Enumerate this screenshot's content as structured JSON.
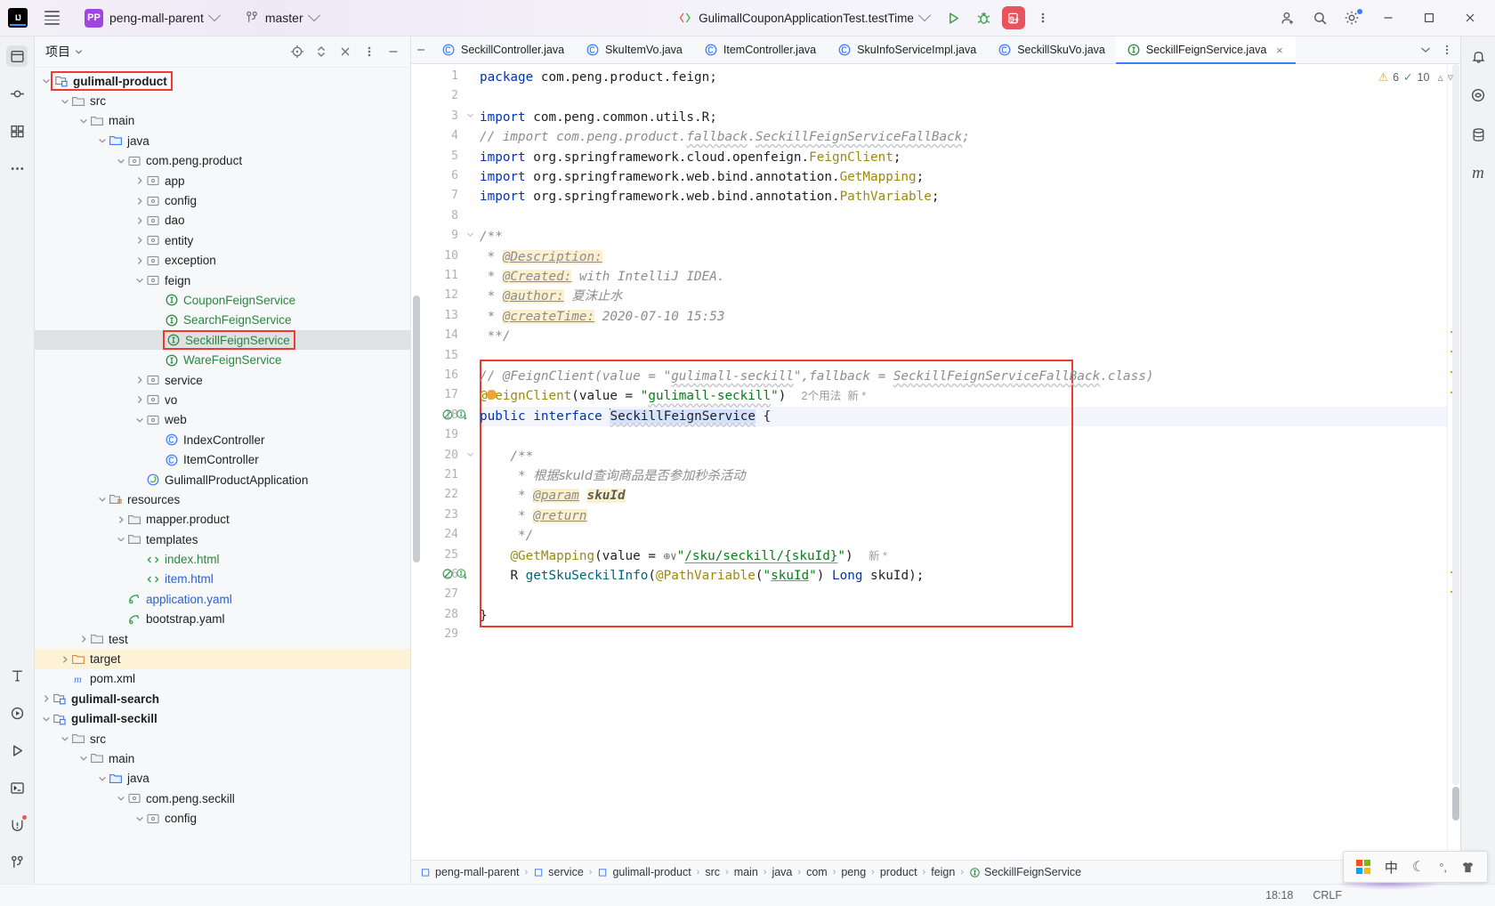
{
  "titlebar": {
    "project_badge": "PP",
    "project_name": "peng-mall-parent",
    "branch": "master",
    "run_config": "GulimallCouponApplicationTest.testTime",
    "debug_badge": "9+",
    "icons": [
      "ij-logo",
      "hamburger-icon",
      "chevron-down-icon",
      "branch-icon",
      "run-icon",
      "debug-icon",
      "services-icon",
      "more-vertical-icon",
      "add-user-icon",
      "search-icon",
      "settings-icon",
      "minimize-icon",
      "maximize-icon",
      "close-icon"
    ]
  },
  "left_rail": {
    "items": [
      {
        "name": "project-tool-icon",
        "glyph": "❐"
      },
      {
        "name": "commit-tool-icon",
        "glyph": "⬡"
      },
      {
        "name": "structure-tool-icon",
        "glyph": "⊞"
      },
      {
        "name": "more-tool-icon",
        "glyph": "⋯"
      }
    ],
    "bottom_items": [
      {
        "name": "ai-assistant-icon",
        "glyph": "Ŧ"
      },
      {
        "name": "run-widget-icon",
        "glyph": "▷"
      },
      {
        "name": "run-tool-icon",
        "glyph": "▷"
      },
      {
        "name": "terminal-tool-icon",
        "glyph": "⌨"
      },
      {
        "name": "problems-tool-icon",
        "glyph": "!"
      },
      {
        "name": "version-control-icon",
        "glyph": "⎇"
      }
    ]
  },
  "right_rail": {
    "items": [
      {
        "name": "notifications-icon",
        "glyph": "🔔"
      },
      {
        "name": "ai-chat-icon",
        "glyph": "◎"
      },
      {
        "name": "database-icon",
        "glyph": "⛃"
      },
      {
        "name": "maven-icon",
        "glyph": "m"
      }
    ]
  },
  "project_panel": {
    "title": "项目",
    "header_icons": [
      "locate-icon",
      "expand-collapse-icon",
      "collapse-all-icon",
      "more-options-icon",
      "hide-panel-icon"
    ],
    "tree": [
      {
        "depth": 1,
        "arrow": "down",
        "icon": "module-icon",
        "label": "gulimall-product",
        "style": "bold",
        "highlight": "red-box"
      },
      {
        "depth": 2,
        "arrow": "down",
        "icon": "folder-icon",
        "label": "src",
        "style": "plain"
      },
      {
        "depth": 3,
        "arrow": "down",
        "icon": "folder-icon",
        "label": "main",
        "style": "plain"
      },
      {
        "depth": 4,
        "arrow": "down",
        "icon": "source-root-icon",
        "label": "java",
        "style": "plain"
      },
      {
        "depth": 5,
        "arrow": "down",
        "icon": "package-icon",
        "label": "com.peng.product",
        "style": "plain"
      },
      {
        "depth": 6,
        "arrow": "right",
        "icon": "package-icon",
        "label": "app",
        "style": "plain"
      },
      {
        "depth": 6,
        "arrow": "right",
        "icon": "package-icon",
        "label": "config",
        "style": "plain"
      },
      {
        "depth": 6,
        "arrow": "right",
        "icon": "package-icon",
        "label": "dao",
        "style": "plain"
      },
      {
        "depth": 6,
        "arrow": "right",
        "icon": "package-icon",
        "label": "entity",
        "style": "plain"
      },
      {
        "depth": 6,
        "arrow": "right",
        "icon": "package-icon",
        "label": "exception",
        "style": "plain"
      },
      {
        "depth": 6,
        "arrow": "down",
        "icon": "package-icon",
        "label": "feign",
        "style": "plain"
      },
      {
        "depth": 7,
        "arrow": "none",
        "icon": "interface-icon",
        "label": "CouponFeignService",
        "style": "plain"
      },
      {
        "depth": 7,
        "arrow": "none",
        "icon": "interface-icon",
        "label": "SearchFeignService",
        "style": "plain"
      },
      {
        "depth": 7,
        "arrow": "none",
        "icon": "interface-icon",
        "label": "SeckillFeignService",
        "style": "plain",
        "selected": true,
        "highlight": "red-box"
      },
      {
        "depth": 7,
        "arrow": "none",
        "icon": "interface-icon",
        "label": "WareFeignService",
        "style": "plain"
      },
      {
        "depth": 6,
        "arrow": "right",
        "icon": "package-icon",
        "label": "service",
        "style": "plain"
      },
      {
        "depth": 6,
        "arrow": "right",
        "icon": "package-icon",
        "label": "vo",
        "style": "plain"
      },
      {
        "depth": 6,
        "arrow": "down",
        "icon": "package-icon",
        "label": "web",
        "style": "plain"
      },
      {
        "depth": 7,
        "arrow": "none",
        "icon": "class-icon",
        "label": "IndexController",
        "style": "plain"
      },
      {
        "depth": 7,
        "arrow": "none",
        "icon": "class-icon",
        "label": "ItemController",
        "style": "plain"
      },
      {
        "depth": 6,
        "arrow": "none",
        "icon": "spring-class-icon",
        "label": "GulimallProductApplication",
        "style": "plain"
      },
      {
        "depth": 4,
        "arrow": "down",
        "icon": "resource-root-icon",
        "label": "resources",
        "style": "plain"
      },
      {
        "depth": 5,
        "arrow": "right",
        "icon": "folder-icon",
        "label": "mapper.product",
        "style": "plain"
      },
      {
        "depth": 5,
        "arrow": "down",
        "icon": "folder-icon",
        "label": "templates",
        "style": "plain"
      },
      {
        "depth": 6,
        "arrow": "none",
        "icon": "html-icon",
        "label": "index.html",
        "style": "green"
      },
      {
        "depth": 6,
        "arrow": "none",
        "icon": "html-icon",
        "label": "item.html",
        "style": "blue"
      },
      {
        "depth": 5,
        "arrow": "none",
        "icon": "yaml-icon",
        "label": "application.yaml",
        "style": "blue"
      },
      {
        "depth": 5,
        "arrow": "none",
        "icon": "yaml-icon",
        "label": "bootstrap.yaml",
        "style": "plain"
      },
      {
        "depth": 3,
        "arrow": "right",
        "icon": "folder-icon",
        "label": "test",
        "style": "plain"
      },
      {
        "depth": 2,
        "arrow": "right",
        "icon": "excluded-folder-icon",
        "label": "target",
        "style": "plain",
        "row_highlight": "target"
      },
      {
        "depth": 2,
        "arrow": "none",
        "icon": "maven-file-icon",
        "label": "pom.xml",
        "style": "plain"
      },
      {
        "depth": 1,
        "arrow": "right",
        "icon": "module-icon",
        "label": "gulimall-search",
        "style": "bold"
      },
      {
        "depth": 1,
        "arrow": "down",
        "icon": "module-icon",
        "label": "gulimall-seckill",
        "style": "bold"
      },
      {
        "depth": 2,
        "arrow": "down",
        "icon": "folder-icon",
        "label": "src",
        "style": "plain"
      },
      {
        "depth": 3,
        "arrow": "down",
        "icon": "folder-icon",
        "label": "main",
        "style": "plain"
      },
      {
        "depth": 4,
        "arrow": "down",
        "icon": "source-root-icon",
        "label": "java",
        "style": "plain"
      },
      {
        "depth": 5,
        "arrow": "down",
        "icon": "package-icon",
        "label": "com.peng.seckill",
        "style": "plain"
      },
      {
        "depth": 6,
        "arrow": "down",
        "icon": "package-icon",
        "label": "config",
        "style": "plain"
      }
    ]
  },
  "editor": {
    "tabs": [
      {
        "label": "SeckillController.java",
        "icon": "class-icon",
        "active": false
      },
      {
        "label": "SkuItemVo.java",
        "icon": "class-icon",
        "active": false
      },
      {
        "label": "ItemController.java",
        "icon": "class-icon",
        "active": false
      },
      {
        "label": "SkuInfoServiceImpl.java",
        "icon": "class-icon",
        "active": false
      },
      {
        "label": "SeckillSkuVo.java",
        "icon": "class-icon",
        "active": false
      },
      {
        "label": "SeckillFeignService.java",
        "icon": "interface-icon",
        "active": true
      }
    ],
    "inspection": {
      "warnings": "6",
      "checks": "10"
    },
    "caret_position": "18:18",
    "line_separator": "CRLF",
    "lines": [
      {
        "n": 1,
        "text": "package com.peng.product.feign;"
      },
      {
        "n": 2,
        "text": ""
      },
      {
        "n": 3,
        "text": "import com.peng.common.utils.R;"
      },
      {
        "n": 4,
        "text": "// import com.peng.product.fallback.SeckillFeignServiceFallBack;"
      },
      {
        "n": 5,
        "text": "import org.springframework.cloud.openfeign.FeignClient;"
      },
      {
        "n": 6,
        "text": "import org.springframework.web.bind.annotation.GetMapping;"
      },
      {
        "n": 7,
        "text": "import org.springframework.web.bind.annotation.PathVariable;"
      },
      {
        "n": 8,
        "text": ""
      },
      {
        "n": 9,
        "text": "/**"
      },
      {
        "n": 10,
        "text": " * @Description:"
      },
      {
        "n": 11,
        "text": " * @Created: with IntelliJ IDEA."
      },
      {
        "n": 12,
        "text": " * @author: 夏沫止水"
      },
      {
        "n": 13,
        "text": " * @createTime: 2020-07-10 15:53"
      },
      {
        "n": 14,
        "text": " **/"
      },
      {
        "n": 15,
        "text": ""
      },
      {
        "n": 16,
        "text": "// @FeignClient(value = \"gulimall-seckill\",fallback = SeckillFeignServiceFallBack.class)"
      },
      {
        "n": 17,
        "text": "@FeignClient(value = \"gulimall-seckill\")  2个用法  新 *"
      },
      {
        "n": 18,
        "text": "public interface SeckillFeignService {"
      },
      {
        "n": 19,
        "text": ""
      },
      {
        "n": 20,
        "text": "    /**"
      },
      {
        "n": 21,
        "text": "     * 根据skuId查询商品是否参加秒杀活动"
      },
      {
        "n": 22,
        "text": "     * @param skuId"
      },
      {
        "n": 23,
        "text": "     * @return"
      },
      {
        "n": 24,
        "text": "     */"
      },
      {
        "n": 25,
        "text": "    @GetMapping(value = \"/sku/seckill/{skuId}\")  新 *"
      },
      {
        "n": 26,
        "text": "    R getSkuSeckilInfo(@PathVariable(\"skuId\") Long skuId);"
      },
      {
        "n": 27,
        "text": ""
      },
      {
        "n": 28,
        "text": "}"
      },
      {
        "n": 29,
        "text": ""
      }
    ],
    "usage_hints": {
      "feign_client": "2个用法  新 *",
      "get_mapping": "新 *"
    }
  },
  "breadcrumb": {
    "items": [
      {
        "label": "peng-mall-parent",
        "icon": "module-small-icon"
      },
      {
        "label": "service",
        "icon": "module-small-icon"
      },
      {
        "label": "gulimall-product",
        "icon": "module-small-icon"
      },
      {
        "label": "src",
        "icon": ""
      },
      {
        "label": "main",
        "icon": ""
      },
      {
        "label": "java",
        "icon": ""
      },
      {
        "label": "com",
        "icon": ""
      },
      {
        "label": "peng",
        "icon": ""
      },
      {
        "label": "product",
        "icon": ""
      },
      {
        "label": "feign",
        "icon": ""
      },
      {
        "label": "SeckillFeignService",
        "icon": "interface-icon"
      }
    ]
  },
  "statusbar": {
    "caret": "18:18",
    "separator": "CRLF"
  },
  "tray": {
    "items": [
      {
        "name": "windows-start-icon",
        "glyph": ""
      },
      {
        "name": "ime-chinese-icon",
        "glyph": "中"
      },
      {
        "name": "moon-icon",
        "glyph": "☾"
      },
      {
        "name": "degree-comma-icon",
        "glyph": "°,"
      },
      {
        "name": "shirt-icon",
        "glyph": "👕"
      }
    ]
  },
  "colors": {
    "accent_blue": "#3d7eff",
    "red_highlight": "#f03a2e",
    "keyword": "#0033b3",
    "string": "#067d17",
    "comment": "#8c8c8c",
    "annotation": "#9e880d",
    "selection": "#d4e2ff",
    "target_row": "#fdf1d6"
  }
}
